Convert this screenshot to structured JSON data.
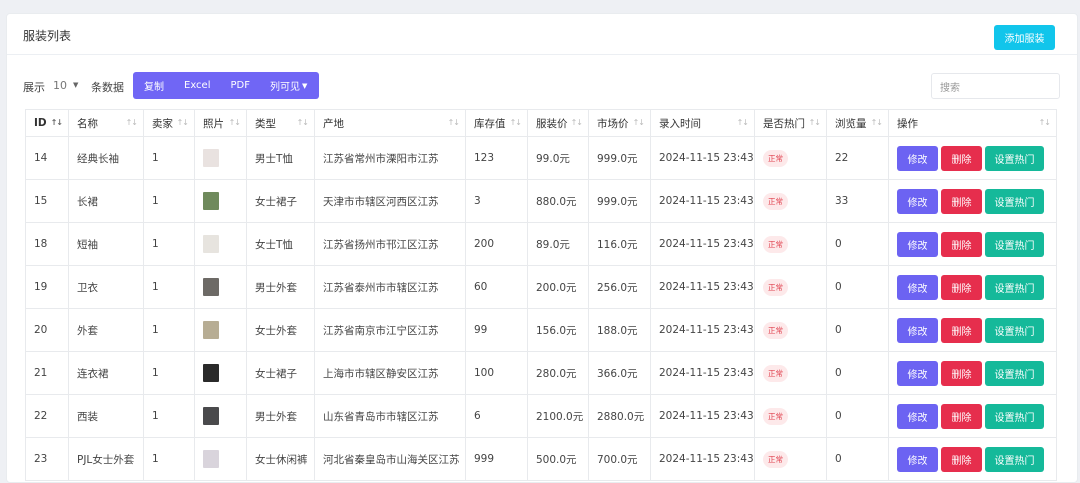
{
  "header": {
    "title": "服装列表",
    "add_button": "添加服装"
  },
  "toolbar": {
    "show_label": "展示",
    "page_length": "10",
    "entries_label": "条数据",
    "buttons": [
      "复制",
      "Excel",
      "PDF",
      "列可见"
    ],
    "search_placeholder": "搜索"
  },
  "columns": [
    "ID",
    "名称",
    "卖家",
    "照片",
    "类型",
    "产地",
    "库存值",
    "服装价",
    "市场价",
    "录入时间",
    "是否热门",
    "浏览量",
    "操作"
  ],
  "rows": [
    {
      "id": "14",
      "name": "经典长袖",
      "seller": "1",
      "type": "男士T恤",
      "origin": "江苏省常州市溧阳市江苏",
      "stock": "123",
      "price": "99.0元",
      "market": "999.0元",
      "time": "2024-11-15 23:43",
      "hot": "正常",
      "views": "22",
      "thumb_color": "#e9e2e0"
    },
    {
      "id": "15",
      "name": "长裙",
      "seller": "1",
      "type": "女士裙子",
      "origin": "天津市市辖区河西区江苏",
      "stock": "3",
      "price": "880.0元",
      "market": "999.0元",
      "time": "2024-11-15 23:43",
      "hot": "正常",
      "views": "33",
      "thumb_color": "#6f8a5c"
    },
    {
      "id": "18",
      "name": "短袖",
      "seller": "1",
      "type": "女士T恤",
      "origin": "江苏省扬州市邗江区江苏",
      "stock": "200",
      "price": "89.0元",
      "market": "116.0元",
      "time": "2024-11-15 23:43",
      "hot": "正常",
      "views": "0",
      "thumb_color": "#e7e4df"
    },
    {
      "id": "19",
      "name": "卫衣",
      "seller": "1",
      "type": "男士外套",
      "origin": "江苏省泰州市市辖区江苏",
      "stock": "60",
      "price": "200.0元",
      "market": "256.0元",
      "time": "2024-11-15 23:43",
      "hot": "正常",
      "views": "0",
      "thumb_color": "#6d6a66"
    },
    {
      "id": "20",
      "name": "外套",
      "seller": "1",
      "type": "女士外套",
      "origin": "江苏省南京市江宁区江苏",
      "stock": "99",
      "price": "156.0元",
      "market": "188.0元",
      "time": "2024-11-15 23:43",
      "hot": "正常",
      "views": "0",
      "thumb_color": "#b7ad94"
    },
    {
      "id": "21",
      "name": "连衣裙",
      "seller": "1",
      "type": "女士裙子",
      "origin": "上海市市辖区静安区江苏",
      "stock": "100",
      "price": "280.0元",
      "market": "366.0元",
      "time": "2024-11-15 23:43",
      "hot": "正常",
      "views": "0",
      "thumb_color": "#2a2a2a"
    },
    {
      "id": "22",
      "name": "西装",
      "seller": "1",
      "type": "男士外套",
      "origin": "山东省青岛市市辖区江苏",
      "stock": "6",
      "price": "2100.0元",
      "market": "2880.0元",
      "time": "2024-11-15 23:43",
      "hot": "正常",
      "views": "0",
      "thumb_color": "#4a4a4c"
    },
    {
      "id": "23",
      "name": "PJL女士外套",
      "seller": "1",
      "type": "女士休闲裤",
      "origin": "河北省秦皇岛市山海关区江苏",
      "stock": "999",
      "price": "500.0元",
      "market": "700.0元",
      "time": "2024-11-15 23:43",
      "hot": "正常",
      "views": "0",
      "thumb_color": "#d9d4dc"
    }
  ],
  "actions": {
    "edit": "修改",
    "delete": "删除",
    "set_hot": "设置热门"
  },
  "colors": {
    "primary": "#6c63f2",
    "danger": "#e62e4d",
    "success": "#15b99a",
    "info": "#11c5eb"
  }
}
